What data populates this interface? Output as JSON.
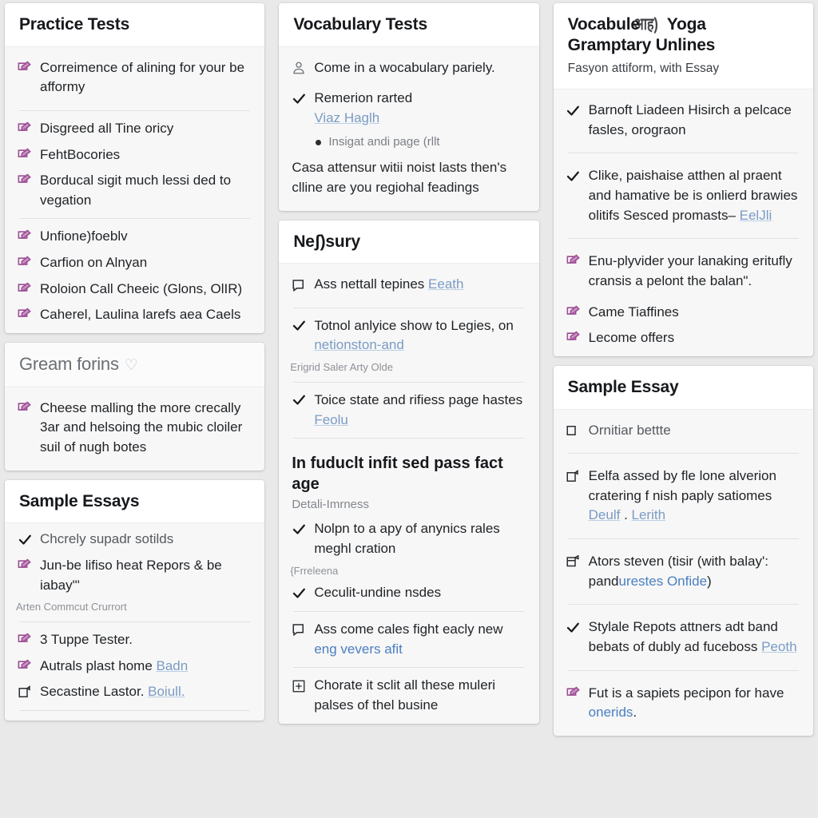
{
  "page": {
    "background": "#e9e9e9",
    "card_background": "#f7f7f7",
    "accent_purple": "#9b4d93",
    "link_blue": "#7a9bc4"
  },
  "columns": [
    {
      "name": "column-left",
      "cards": [
        {
          "title": "Practice Tests",
          "rows": [
            {
              "icon": "checkbox-pen-icon",
              "text": "Correimence of alining for your be afformy"
            },
            {
              "separator": true
            },
            {
              "icon": "checkbox-pen-icon",
              "text": "Disgreed all Tine oricy"
            },
            {
              "icon": "checkbox-pen-icon",
              "text": "FehtBocories"
            },
            {
              "icon": "checkbox-pen-icon",
              "text": "Borducal sigit much lessi ded to vegation"
            },
            {
              "separator": true
            },
            {
              "icon": "checkbox-pen-icon",
              "text": "Unfione)foeblv"
            },
            {
              "icon": "checkbox-pen-icon",
              "text": "Carfion on Alnyan"
            },
            {
              "icon": "checkbox-pen-icon",
              "text": "Roloion Call Cheeic (Glons, OlIR)"
            },
            {
              "icon": "checkbox-pen-icon",
              "text": "Caherel, Laulina larefs aea Caels"
            }
          ]
        },
        {
          "title": "Gream forins",
          "title_style": "light",
          "title_icon": "heart-icon",
          "rows": [
            {
              "icon": "checkbox-pen-icon",
              "text": "Cheese malling the more crecally 3ar and helsoing the mubic cloiler suil of nugh botes"
            }
          ]
        },
        {
          "title": "Sample Essays",
          "rows": [
            {
              "icon": "check-icon",
              "text": "Chcrely supadr sotilds"
            },
            {
              "icon": "checkbox-pen-icon",
              "text": "Jun-be lifiso heat Repors & be iabay\"'"
            },
            {
              "icon": "none",
              "text": "Arten Commcut Crurrort",
              "style": "small"
            },
            {
              "separator": true
            },
            {
              "icon": "checkbox-pen-icon",
              "text": "3 Tuppe Tester."
            },
            {
              "icon": "checkbox-pen-icon",
              "text": "Autrals plast home ",
              "link": "Badn"
            },
            {
              "icon": "checkbox-empty-icon",
              "text": "Secastine Lastor. ",
              "link": "Boiull."
            },
            {
              "separator": true
            }
          ]
        }
      ]
    },
    {
      "name": "column-middle",
      "cards": [
        {
          "title": "Vocabulary Tests",
          "rows": [
            {
              "icon": "user-icon",
              "text": "Come in a wocabulary pariely."
            },
            {
              "icon": "check-icon",
              "text": "Remerion rarted ",
              "link": "Viaz Haglh"
            },
            {
              "icon": "bullet-icon",
              "text": "Insigat andi page (rllt",
              "style": "muted",
              "indent": true
            },
            {
              "icon": "none",
              "text": "Casa attensur witii noist lasts then's clline are you regiohal feadings",
              "style": "para"
            }
          ]
        },
        {
          "title": "Neʃ)sury",
          "rows": [
            {
              "icon": "comment-icon",
              "text": "Ass nettall tepines ",
              "link": "Eeath"
            },
            {
              "separator": true
            },
            {
              "icon": "check-icon",
              "text": "Totnol anlyice show to Legies, on ",
              "link": "netionston-and"
            },
            {
              "icon": "none",
              "text": "Erigrid Saler Arty Olde",
              "style": "small"
            },
            {
              "separator": true
            },
            {
              "icon": "check-icon",
              "text": "Toice state and rifiess page hastes ",
              "link": "Feolu"
            },
            {
              "separator": true
            },
            {
              "icon": "none",
              "text": "In fuduclt infit sed pass fact age",
              "style": "bold-head"
            },
            {
              "icon": "none",
              "text": "Detali-Imrness",
              "style": "sub-head"
            },
            {
              "icon": "check-icon",
              "text": "Nolpn to a apy of anynics rales meghl cration"
            },
            {
              "icon": "none",
              "text": "{Frreleena",
              "style": "small"
            },
            {
              "icon": "check-icon",
              "text": "Ceculit-undine nsdes"
            },
            {
              "separator": true
            },
            {
              "icon": "comment-icon",
              "text": "Ass come cales fight eacly new ",
              "link": "eng vevers afit",
              "link_strong": true
            },
            {
              "separator": true
            },
            {
              "icon": "frame-plus-icon",
              "text": "Chorate it sclit all these muleri palses of thel busine"
            }
          ]
        }
      ]
    },
    {
      "name": "column-right",
      "cards": [
        {
          "title": "Vocabule",
          "title_ghost": "आह)",
          "title_tail": "Yoga",
          "title_line2": "Gramptary Unlines",
          "subtitle": "Fasyon attiform, with Essay",
          "rows": [
            {
              "separator": true
            },
            {
              "icon": "check-icon",
              "text": "Barnoft Liadeen Hisirch a pelcace fasles, orograon"
            },
            {
              "separator": true
            },
            {
              "icon": "check-icon",
              "text": "Clike, paishaise atthen al praent and hamative be is onlierd brawies olitifs Sesced promasts– ",
              "link": "EelJli"
            },
            {
              "separator": true
            },
            {
              "icon": "checkbox-pen-icon",
              "text": "Enu-plyvider your lanaking eritufly cransis a pelont the balan\"."
            },
            {
              "icon": "checkbox-pen-icon",
              "text": "Came Tiaffines"
            },
            {
              "icon": "checkbox-pen-icon",
              "text": "Lecome offers"
            }
          ]
        },
        {
          "title": "Sample Essay",
          "rows": [
            {
              "icon": "checkbox-empty-icon",
              "text": "Ornitiar bettte"
            },
            {
              "separator": true
            },
            {
              "icon": "checkbox-empty-icon",
              "text": "Eelfa assed by fle lone alverion cratering f nish paply satiomes ",
              "link": "Deulf",
              "link2": "Lerith"
            },
            {
              "separator": true
            },
            {
              "icon": "external-window-icon",
              "text": "Ators steven (tisir (with balayʹ: pand",
              "link": "urestes Onfide",
              "link_strong": true,
              "tail": ")"
            },
            {
              "separator": true
            },
            {
              "icon": "check-icon",
              "text": "Stylale Repots attners adt band bebats of dubly ad fuceboss ",
              "link": "Peoth"
            },
            {
              "separator": true
            },
            {
              "icon": "checkbox-pen-icon",
              "text": "Fut is a sapiets pecipon for have ",
              "link": "onerids",
              "link_strong": true,
              "tail": "."
            }
          ]
        }
      ]
    }
  ]
}
